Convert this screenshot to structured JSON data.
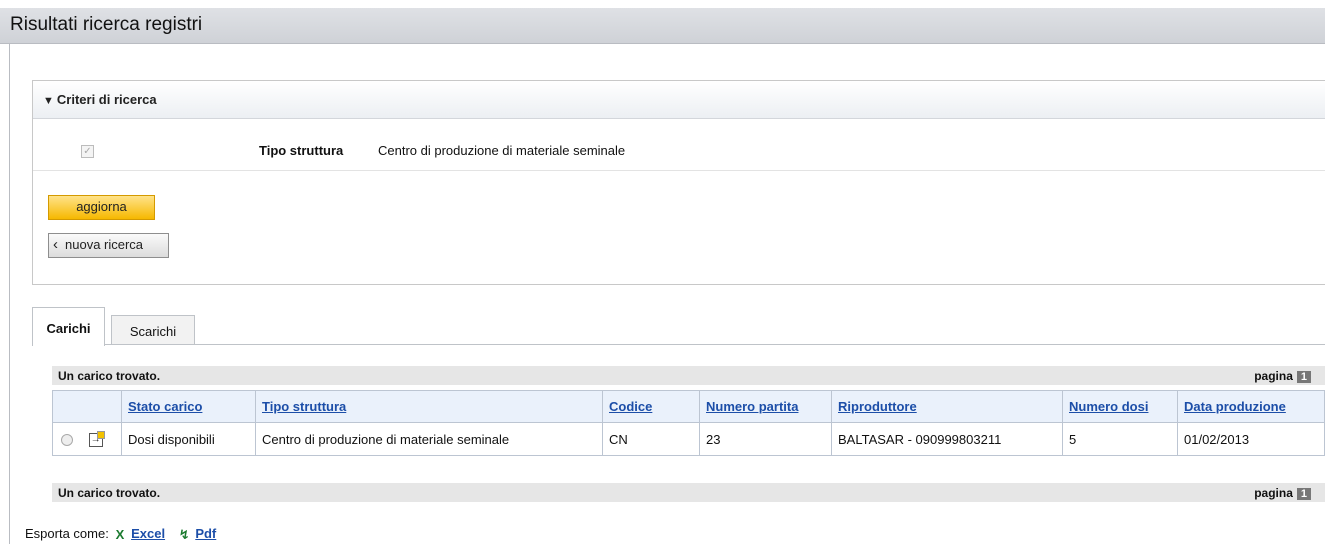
{
  "page": {
    "title": "Risultati ricerca registri"
  },
  "criteria": {
    "header": "Criteri di ricerca",
    "row": {
      "label": "Tipo struttura",
      "value": "Centro di produzione di materiale seminale"
    },
    "aggiorna_label": "aggiorna",
    "nuova_label": "nuova ricerca"
  },
  "tabs": [
    {
      "label": "Carichi",
      "active": true
    },
    {
      "label": "Scarichi",
      "active": false
    }
  ],
  "results": {
    "summary": "Un carico trovato.",
    "pagina_label": "pagina",
    "pagina_num": "1",
    "columns": [
      "Stato carico",
      "Tipo struttura",
      "Codice",
      "Numero partita",
      "Riproduttore",
      "Numero dosi",
      "Data produzione"
    ],
    "rows": [
      [
        "Dosi disponibili",
        "Centro di produzione di materiale seminale",
        "CN",
        "23",
        "BALTASAR - 090999803211",
        "5",
        "01/02/2013"
      ]
    ]
  },
  "export": {
    "label": "Esporta come:",
    "excel": "Excel",
    "pdf": "Pdf"
  }
}
